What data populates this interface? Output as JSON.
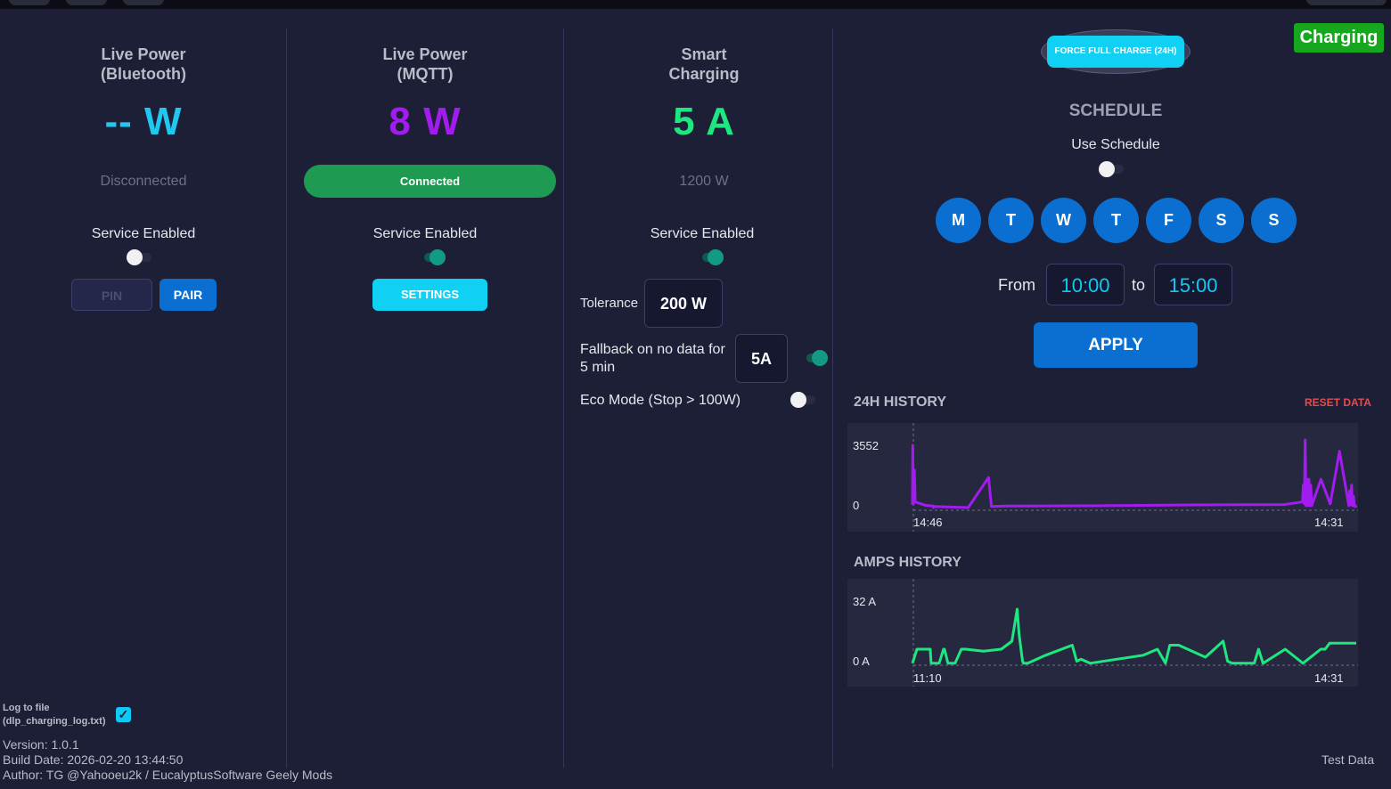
{
  "bluetooth": {
    "title_line1": "Live Power",
    "title_line2": "(Bluetooth)",
    "value": "-- W",
    "status": "Disconnected",
    "service_label": "Service Enabled",
    "service_enabled": false,
    "pin_label": "PIN",
    "pair_label": "PAIR"
  },
  "mqtt": {
    "title_line1": "Live Power",
    "title_line2": "(MQTT)",
    "value": "8 W",
    "status": "Connected",
    "service_label": "Service Enabled",
    "service_enabled": true,
    "settings_label": "SETTINGS"
  },
  "smart": {
    "title_line1": "Smart",
    "title_line2": "Charging",
    "value": "5 A",
    "power": "1200 W",
    "service_label": "Service Enabled",
    "service_enabled": true,
    "tolerance_label": "Tolerance",
    "tolerance_value": "200 W",
    "fallback_label_line1": "Fallback on no data for",
    "fallback_label_line2": "5 min",
    "fallback_value": "5A",
    "fallback_enabled": true,
    "eco_label": "Eco Mode (Stop > 100W)",
    "eco_enabled": false
  },
  "right": {
    "force_label": "FORCE FULL CHARGE (24H)",
    "status_badge": "Charging",
    "schedule_title": "SCHEDULE",
    "use_schedule_label": "Use Schedule",
    "use_schedule": false,
    "days": [
      "M",
      "T",
      "W",
      "T",
      "F",
      "S",
      "S"
    ],
    "from_label": "From",
    "from_time": "10:00",
    "to_label": "to",
    "to_time": "15:00",
    "apply_label": "APPLY",
    "history_title": "24H HISTORY",
    "reset_label": "RESET DATA",
    "amps_title": "AMPS HISTORY"
  },
  "footer": {
    "log_label_line1": "Log to file",
    "log_label_line2": "(dlp_charging_log.txt)",
    "log_checked": true,
    "version": "Version: 1.0.1",
    "build_date": "Build Date: 2026-02-20 13:44:50",
    "author": "Author: TG @Yahooeu2k / EucalyptusSoftware Geely Mods",
    "test_data": "Test Data"
  },
  "chart_data": [
    {
      "type": "line",
      "title": "24H HISTORY",
      "yticks": [
        "3552",
        "0"
      ],
      "xticks": [
        "14:46",
        "14:31"
      ],
      "ylim": [
        0,
        3552
      ],
      "color": "#a21cf0",
      "series": [
        {
          "x": [
            0,
            0.3,
            1,
            2,
            3,
            14,
            22,
            22.5,
            23,
            60,
            82,
            85,
            100,
            200,
            300,
            400,
            420,
            421,
            422,
            423,
            424,
            425,
            426,
            427,
            428,
            429,
            430,
            440,
            450,
            460,
            470,
            471,
            472,
            473,
            474,
            475,
            476,
            477,
            478
          ],
          "y": [
            150,
            3300,
            200,
            2000,
            300,
            120,
            90,
            0,
            60,
            0,
            1600,
            60,
            80,
            100,
            140,
            160,
            300,
            1200,
            200,
            3600,
            100,
            1500,
            100,
            1500,
            100,
            1200,
            100,
            1500,
            200,
            3000,
            100,
            900,
            150,
            1200,
            100,
            600,
            80,
            100,
            0
          ]
        }
      ]
    },
    {
      "type": "line",
      "title": "AMPS HISTORY",
      "yticks": [
        "32 A",
        "0 A"
      ],
      "xticks": [
        "11:10",
        "14:31"
      ],
      "ylim": [
        0,
        32
      ],
      "color": "#1de880",
      "series": [
        {
          "x": [
            0,
            5,
            20,
            21,
            30,
            35,
            36,
            40,
            48,
            55,
            60,
            80,
            100,
            112,
            118,
            120,
            124,
            125,
            130,
            150,
            180,
            185,
            190,
            200,
            260,
            276,
            285,
            290,
            300,
            330,
            350,
            355,
            360,
            385,
            390,
            395,
            420,
            440,
            460,
            465,
            470,
            500
          ],
          "y": [
            1,
            8,
            8,
            1,
            1,
            8,
            8,
            1,
            1,
            8,
            8,
            7,
            8,
            12,
            28,
            16,
            2,
            1,
            1,
            5,
            10,
            2,
            3,
            1,
            5,
            8,
            1,
            10,
            10,
            4,
            12,
            2,
            1,
            1,
            8,
            1,
            8,
            1,
            8,
            8,
            11,
            11
          ]
        }
      ]
    }
  ]
}
